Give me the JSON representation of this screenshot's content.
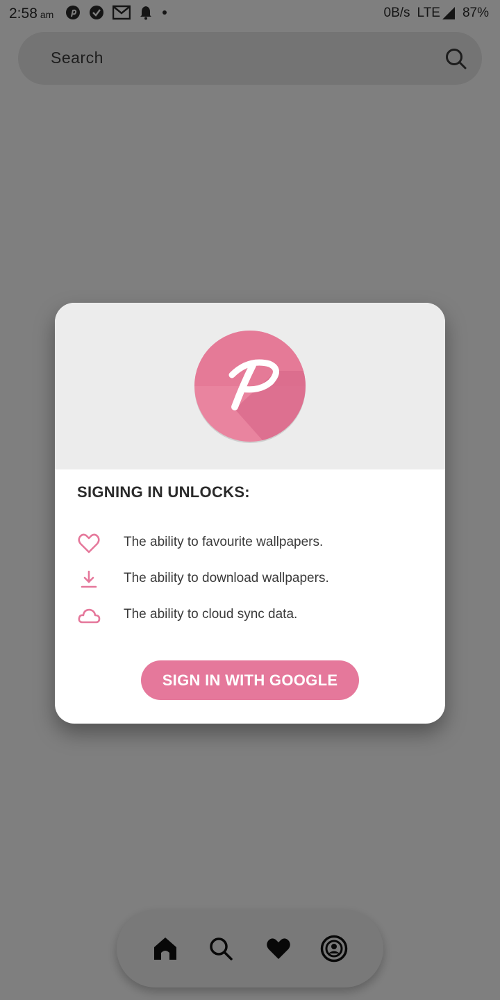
{
  "status_bar": {
    "time": "2:58",
    "ampm": "am",
    "network_speed": "0B/s",
    "network_type": "LTE",
    "battery": "87%",
    "notification_icons": [
      "pinterest-icon",
      "check-circle-icon",
      "gmail-icon",
      "bell-icon",
      "dot-icon"
    ]
  },
  "search": {
    "placeholder": "Search"
  },
  "dialog": {
    "title": "SIGNING IN UNLOCKS:",
    "features": [
      {
        "icon": "heart-outline-icon",
        "text": "The ability to favourite wallpapers."
      },
      {
        "icon": "download-icon",
        "text": "The ability to download wallpapers."
      },
      {
        "icon": "cloud-icon",
        "text": "The ability to cloud sync data."
      }
    ],
    "button_label": "SIGN IN WITH GOOGLE",
    "logo_letter": "P"
  },
  "bottom_nav": {
    "items": [
      "home-icon",
      "search-icon",
      "heart-icon",
      "account-icon"
    ]
  },
  "colors": {
    "accent": "#e5789b",
    "logo_light": "#e9849f",
    "logo_shadow": "#d96c8c",
    "scrim": "rgba(0,0,0,0.5)"
  }
}
